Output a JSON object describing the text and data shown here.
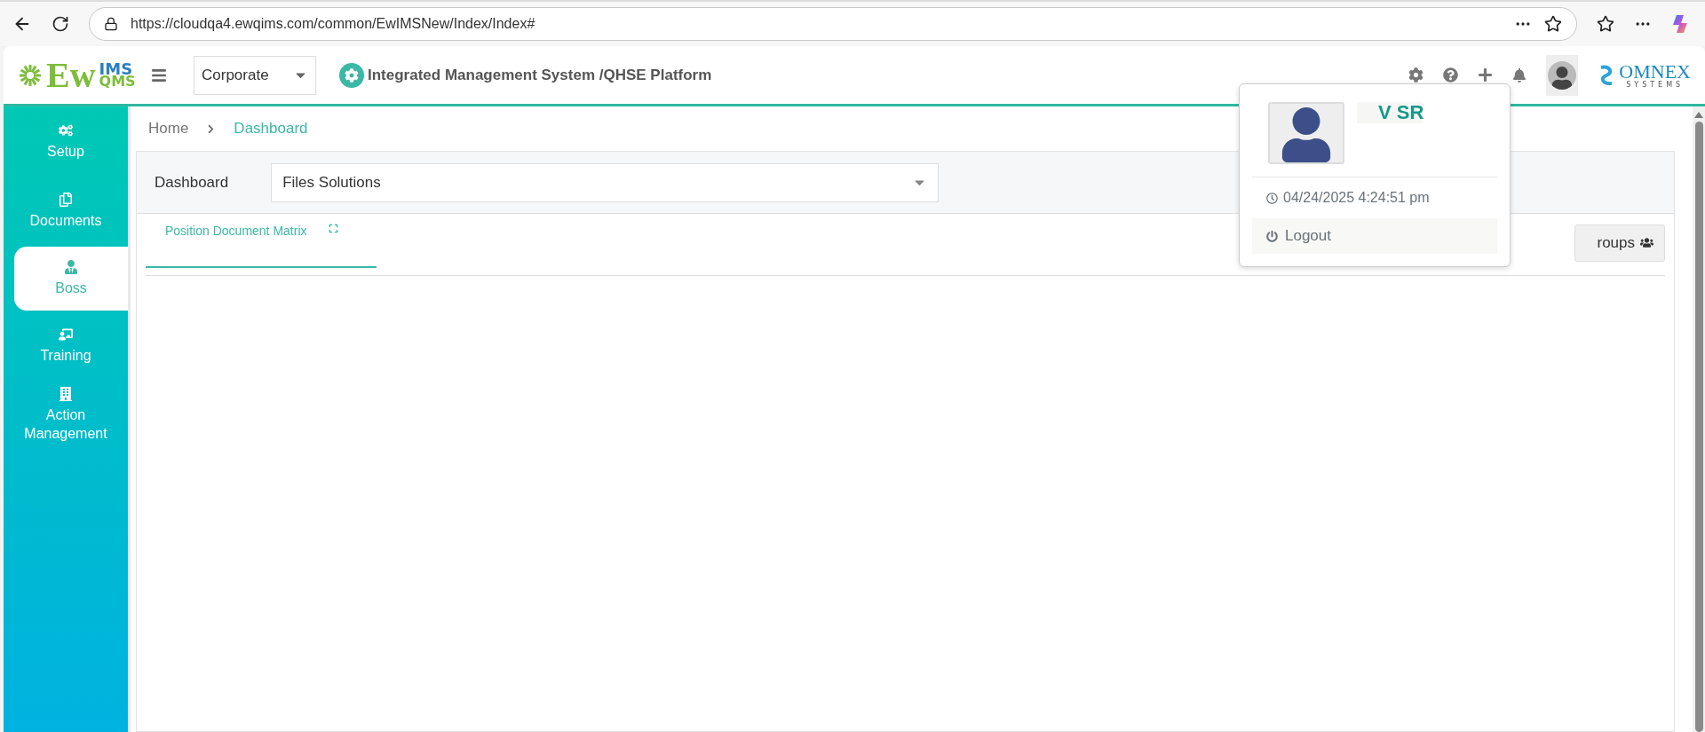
{
  "browser": {
    "url": "https://cloudqa4.ewqims.com/common/EwIMSNew/Index/Index#"
  },
  "header": {
    "logo": {
      "main": "Ew",
      "top": "IMS",
      "bottom": "QMS"
    },
    "site_select": "Corporate",
    "title": "Integrated Management System /QHSE Platform",
    "brand": {
      "name": "OMNEX",
      "sub": "SYSTEMS"
    }
  },
  "sidebar": {
    "items": [
      {
        "label": "Setup",
        "selected": false
      },
      {
        "label": "Documents",
        "selected": false
      },
      {
        "label": "Boss",
        "selected": true
      },
      {
        "label": "Training",
        "selected": false
      },
      {
        "label": "Action Management",
        "selected": false
      }
    ]
  },
  "breadcrumb": [
    {
      "label": "Home",
      "current": false
    },
    {
      "label": "Dashboard",
      "current": true
    }
  ],
  "dashboard": {
    "label": "Dashboard",
    "value": "Files Solutions"
  },
  "tabs": [
    {
      "label": "Position Document Matrix",
      "selected": true
    }
  ],
  "groups_button": "roups",
  "user_menu": {
    "name": "V SR",
    "login_time": "04/24/2025 4:24:51 pm",
    "logout": "Logout"
  }
}
